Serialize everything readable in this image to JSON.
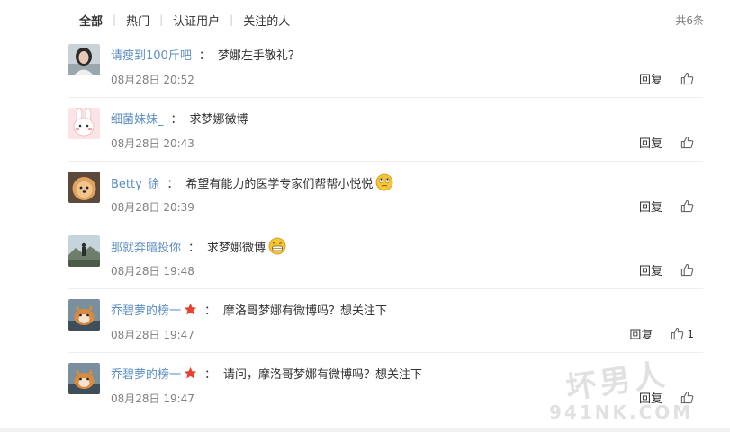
{
  "tabs": [
    "全部",
    "热门",
    "认证用户",
    "关注的人"
  ],
  "total_count": "共6条",
  "reply_label": "回复",
  "comments": [
    {
      "username": "请瘦到100斤吧",
      "colon": "：",
      "text": "梦娜左手敬礼？",
      "time": "08月28日 20:52",
      "likes": "",
      "avatar": "woman-portrait",
      "emoji": "",
      "badge": ""
    },
    {
      "username": "细菌妹妹_",
      "colon": "：",
      "text": "求梦娜微博",
      "time": "08月28日 20:43",
      "likes": "",
      "avatar": "rabbit-cartoon",
      "emoji": "",
      "badge": ""
    },
    {
      "username": "Betty_徐",
      "colon": "：",
      "text": "希望有能力的医学专家们帮帮小悦悦",
      "time": "08月28日 20:39",
      "likes": "",
      "avatar": "pomeranian-dog",
      "emoji": "rolling-eyes-emoji",
      "badge": ""
    },
    {
      "username": "那就奔暗投你",
      "colon": "：",
      "text": "求梦娜微博",
      "time": "08月28日 19:48",
      "likes": "",
      "avatar": "landscape",
      "emoji": "grinning-emoji",
      "badge": ""
    },
    {
      "username": "乔碧萝的榜一",
      "colon": "：",
      "text": "摩洛哥梦娜有微博吗？想关注下",
      "time": "08月28日 19:47",
      "likes": "1",
      "avatar": "cat-photo",
      "emoji": "",
      "badge": "red-star-icon"
    },
    {
      "username": "乔碧萝的榜一",
      "colon": "：",
      "text": "请问，摩洛哥梦娜有微博吗？想关注下",
      "time": "08月28日 19:47",
      "likes": "",
      "avatar": "cat-photo",
      "emoji": "",
      "badge": "red-star-icon"
    }
  ],
  "watermark": {
    "line1": "坏男人",
    "line2": "941NK.COM"
  },
  "colors": {
    "username": "#5b8ec3",
    "time": "#808080",
    "star": "#e8412f",
    "emoji": "#f6c635"
  }
}
